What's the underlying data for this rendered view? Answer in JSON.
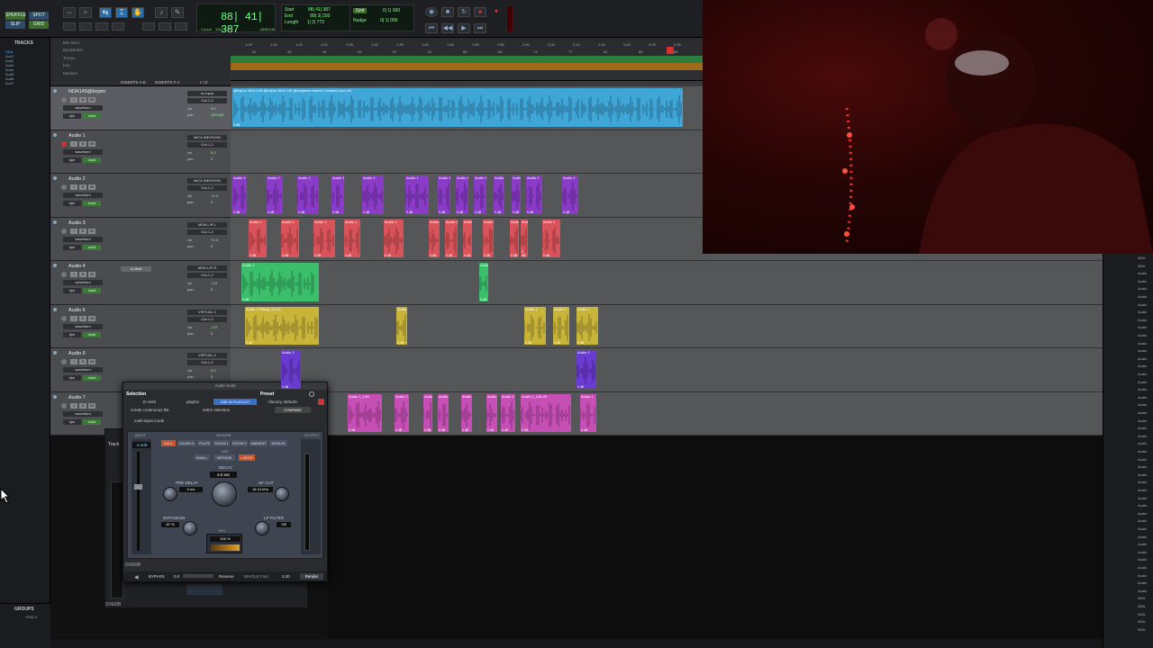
{
  "toolbar": {
    "mode_buttons": [
      "SHUFFLE",
      "SPOT",
      "SLIP",
      "GRID"
    ],
    "main_counter": "88| 41| 387",
    "cursor_label": "Cursor",
    "cursor_value": "100| 3| 207",
    "cursor_value2": "-6659108",
    "sub_counter": {
      "start_label": "Start",
      "start": "88| 41| 387",
      "end_label": "End",
      "end": "88| 3| 200",
      "length_label": "Length",
      "length": "1| 2| 773"
    },
    "grid_label": "Grid",
    "grid_value": "0| 1| 000",
    "nudge_label": "Nudge",
    "nudge_value": "0| 1| 000",
    "dly_label": "Dly"
  },
  "tracks_panel": {
    "title": "TRACKS",
    "items": [
      "NDA",
      "Aud1",
      "Aud2",
      "Aud3",
      "Aud4",
      "Aud5",
      "Aud6",
      "Aud7"
    ]
  },
  "rulers": {
    "names": [
      "Min:Secs",
      "Bars|Beats",
      "Tempo",
      "Key",
      "Markers"
    ],
    "ticks": [
      "1:05",
      "1:10",
      "1:15",
      "1:20",
      "1:25",
      "1:30",
      "1:35",
      "1:40",
      "1:45",
      "1:50",
      "1:55",
      "2:00",
      "2:05",
      "2:10",
      "2:15",
      "2:20",
      "2:25",
      "2:30"
    ],
    "bar_ticks": [
      "41",
      "45",
      "49",
      "53",
      "57",
      "61",
      "65",
      "69",
      "73",
      "77",
      "81",
      "85",
      "89"
    ]
  },
  "column_headers": {
    "inserts_ae": "INSERTS A-E",
    "inserts_fj": "INSERTS F-J",
    "io": "I / O"
  },
  "tracks": [
    {
      "name": "NDA145@bnjmn",
      "io_in": "no input",
      "io_out": "Out 1-2",
      "vol": "0.0",
      "pan": "100  100",
      "mode": "waveform",
      "clip_label": "@bnjmn NDA 145 @bnjmn  NDA 145 @benjamin baxter x kristian nuvo 84",
      "insert": ""
    },
    {
      "name": "Audio 1",
      "io_in": "MIC/LINE/HIZ/IN",
      "io_out": "Out 1-2",
      "vol": "0.0",
      "pan": "0",
      "mode": "waveform",
      "insert": ""
    },
    {
      "name": "Audio 2",
      "io_in": "MIC/LINE/HIZ/IN",
      "io_out": "Out 1-2",
      "vol": "+1.3",
      "pan": "0",
      "mode": "waveform",
      "insert": ""
    },
    {
      "name": "Audio 3",
      "io_in": "MON L/R L",
      "io_out": "Out 1-2",
      "vol": "+1.3",
      "pan": "0",
      "mode": "waveform",
      "insert": ""
    },
    {
      "name": "Audio 4",
      "io_in": "MON L/R R",
      "io_out": "Out 1-2",
      "vol": "-2.0",
      "pan": "0",
      "mode": "waveform",
      "insert": "D-Verb"
    },
    {
      "name": "Audio 5",
      "io_in": "VIRTUAL 1",
      "io_out": "Out 1-2",
      "vol": "-2.0",
      "pan": "0",
      "mode": "waveform",
      "insert": ""
    },
    {
      "name": "Audio 6",
      "io_in": "VIRTUAL 2",
      "io_out": "Out 1-2",
      "vol": "0.0",
      "pan": "0",
      "mode": "waveform",
      "insert": ""
    },
    {
      "name": "Audio 7",
      "io_in": "",
      "io_out": "",
      "vol": "",
      "pan": "",
      "mode": "waveform",
      "insert": ""
    }
  ],
  "clip_labels": {
    "audio5_first": "Audio 1-Pitch#_18-13",
    "audio7_a": "Audio 1_146-",
    "audio7_b": "Audio 1_146-20",
    "gain": "0 dB",
    "generic": "Audio 1"
  },
  "plugin": {
    "window_title": "Audio Suite",
    "selection_label": "Selection",
    "preset_label": "Preset",
    "plugin_name": "D-Verb",
    "playlist": "playlist",
    "use_in_playlist": "USE IN PLAYLIST",
    "factory_default": "<factory default>",
    "create_mode": "create continuous file",
    "entire_selection": "entire selection",
    "multi_input": "multi-input mode",
    "compare": "COMPARE",
    "track_label": "Track",
    "input_label": "INPUT",
    "output_label": "OUTPUT",
    "gain_value": "-4.0dB",
    "reverb_label": "REVERB",
    "reverb_types": [
      "HALL",
      "CHURCH",
      "PLATE",
      "ROOM 1",
      "ROOM 2",
      "AMBIENT",
      "NONLIN"
    ],
    "size_label": "SIZE",
    "sizes": [
      "SMALL",
      "MEDIUM",
      "LARGE"
    ],
    "decay_label": "DECAY",
    "decay_value": "4.5 sec",
    "predelay_label": "PRE DELAY",
    "predelay_value": "0 ms",
    "hfcut_label": "HF CUT",
    "hfcut_value": "16.10 kHz",
    "diffusion_label": "DIFFUSION",
    "diffusion_value": "87 %",
    "lpfilter_label": "LP FILTER",
    "lpfilter_value": "Off",
    "mix_label": "MIX",
    "mix_value": "100 %",
    "footer_name": "DVERB",
    "bypass": "BYPASS",
    "bypass_value": "0.0",
    "reverse": "Reverse",
    "whole_file": "WHOLE FILE",
    "whole_value": "2.00",
    "render": "Render",
    "bottom_label": "DVERB"
  },
  "groups_panel": {
    "title": "GROUPS",
    "item": "<ALL>"
  },
  "right_panel": {
    "items": [
      "NDA",
      "NDA",
      "Audio",
      "Audio",
      "Audio",
      "Audio",
      "Audio",
      "Audio",
      "Audio",
      "Audio",
      "Audio",
      "Audio",
      "Audio",
      "Audio",
      "Audio",
      "Audio",
      "Audio",
      "Audio",
      "Audio",
      "Audio",
      "Audio",
      "Audio",
      "Audio",
      "Audio",
      "Audio",
      "Audio",
      "Audio",
      "Audio",
      "Audio",
      "Audio",
      "Audio",
      "Audio",
      "Audio",
      "Audio",
      "Audio",
      "Audio",
      "Audio",
      "Audio",
      "Audio",
      "Audio",
      "Audio",
      "Audio",
      "Audio",
      "Audio",
      "NDA",
      "NDA",
      "NDA",
      "NDA",
      "NDA"
    ]
  },
  "colors": {
    "nda": "#3fa6d8",
    "audio2": "#8a3bc8",
    "audio3": "#d9545a",
    "audio4": "#3bbf6a",
    "audio5": "#c9b43a",
    "audio6": "#6a3bd0",
    "audio7": "#c64fb5",
    "counter_green": "#6fff8a"
  }
}
